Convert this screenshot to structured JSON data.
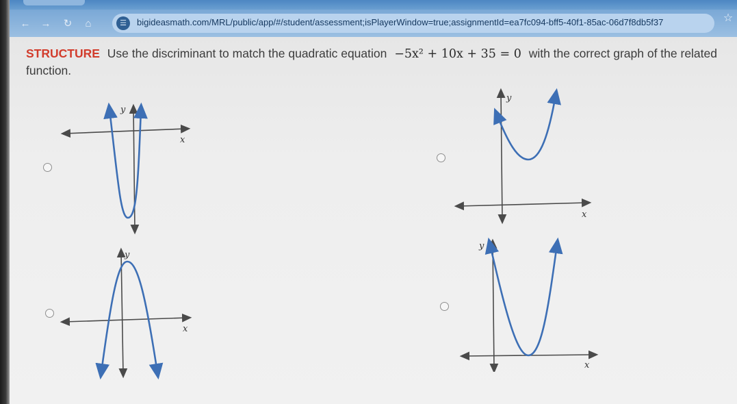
{
  "browser": {
    "url": "bigideasmath.com/MRL/public/app/#/student/assessment;isPlayerWindow=true;assignmentId=ea7fc094-bff5-40f1-85ac-06d7f8db5f37",
    "back_icon": "back-arrow-icon",
    "forward_icon": "forward-arrow-icon",
    "reload_icon": "reload-icon",
    "home_icon": "home-icon",
    "site_icon": "site-settings-icon",
    "star_icon": "bookmark-star-icon"
  },
  "question": {
    "label": "STRUCTURE",
    "text_before": "Use the discriminant to match the quadratic equation",
    "equation": "−5x² + 10x + 35 = 0",
    "text_after": "with the correct graph of the related function."
  },
  "options": [
    {
      "id": "A",
      "graph": "narrow upward parabola, vertex below x-axis, two x-intercepts",
      "selected": false
    },
    {
      "id": "B",
      "graph": "upward parabola, vertex above x-axis, no x-intercepts",
      "selected": false
    },
    {
      "id": "C",
      "graph": "downward parabola, vertex above x-axis, two x-intercepts",
      "selected": false
    },
    {
      "id": "D",
      "graph": "upward parabola, vertex on x-axis, one x-intercept",
      "selected": false
    }
  ],
  "axis_labels": {
    "x": "x",
    "y": "y"
  },
  "colors": {
    "label_accent": "#d23c2c",
    "curve": "#3d6fb5",
    "browser_bar": "#7aa8d6"
  }
}
